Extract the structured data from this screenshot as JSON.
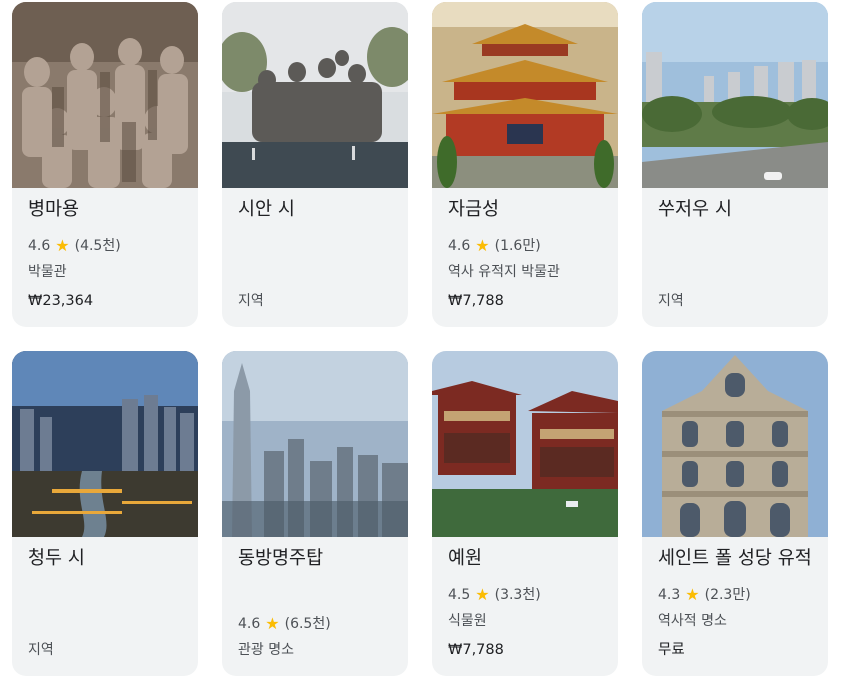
{
  "cards": [
    {
      "title": "병마용",
      "rating": "4.6",
      "reviews": "(4.5천)",
      "category": "박물관",
      "price": "₩23,364",
      "image": "terracotta-warriors-photo"
    },
    {
      "title": "시안 시",
      "category": "지역",
      "image": "xian-city-statues-photo"
    },
    {
      "title": "자금성",
      "rating": "4.6",
      "reviews": "(1.6만)",
      "category": "역사 유적지 박물관",
      "price": "₩7,788",
      "image": "forbidden-city-photo"
    },
    {
      "title": "쑤저우 시",
      "category": "지역",
      "image": "suzhou-city-skyline-photo"
    },
    {
      "title": "청두 시",
      "category": "지역",
      "image": "chengdu-city-night-photo"
    },
    {
      "title": "동방명주탑",
      "rating": "4.6",
      "reviews": "(6.5천)",
      "category": "관광 명소",
      "image": "oriental-pearl-tower-photo"
    },
    {
      "title": "예원",
      "rating": "4.5",
      "reviews": "(3.3천)",
      "category": "식물원",
      "price": "₩7,788",
      "image": "yu-garden-photo"
    },
    {
      "title": "세인트 폴 성당 유적",
      "rating": "4.3",
      "reviews": "(2.3만)",
      "category": "역사적 명소",
      "price": "무료",
      "image": "ruins-of-st-paul-photo"
    }
  ],
  "colors": {
    "card_bg": "#f1f3f4",
    "star": "#fbbc04",
    "title": "#202124",
    "secondary": "#4d5156"
  }
}
